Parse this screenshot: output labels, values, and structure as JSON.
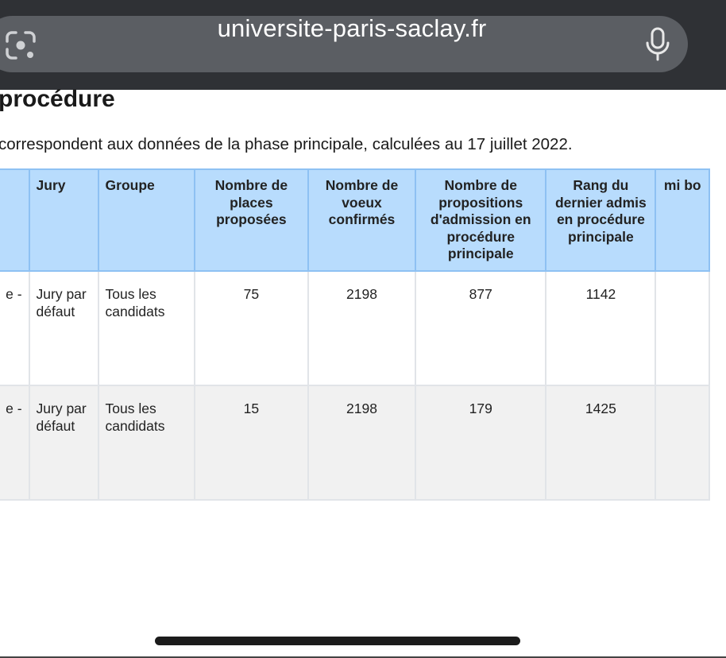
{
  "browser": {
    "url": "universite-paris-saclay.fr",
    "icons": {
      "lens": "lens-icon",
      "mic": "microphone-icon"
    }
  },
  "page": {
    "title": "procédure",
    "subtitle": "correspondent aux données de la phase principale, calculées au 17 juillet 2022."
  },
  "table": {
    "headers": [
      "",
      "Jury",
      "Groupe",
      "Nombre de places proposées",
      "Nombre de voeux confirmés",
      "Nombre de propositions d'admission en procédure principale",
      "Rang du dernier admis en procédure principale",
      "mi bo"
    ],
    "rows": [
      {
        "cut": "e -",
        "jury": "Jury par défaut",
        "groupe": "Tous les candidats",
        "places": "75",
        "voeux": "2198",
        "propositions": "877",
        "rang": "1142",
        "extra": ""
      },
      {
        "cut": "e -",
        "jury": "Jury par défaut",
        "groupe": "Tous les candidats",
        "places": "15",
        "voeux": "2198",
        "propositions": "179",
        "rang": "1425",
        "extra": ""
      }
    ]
  },
  "colors": {
    "header_bg": "#b8dcfd",
    "header_border": "#8ec1f3",
    "row_alt_bg": "#f1f1f1",
    "topbar_bg": "#2f3135",
    "urlbar_bg": "#5b5e63"
  }
}
